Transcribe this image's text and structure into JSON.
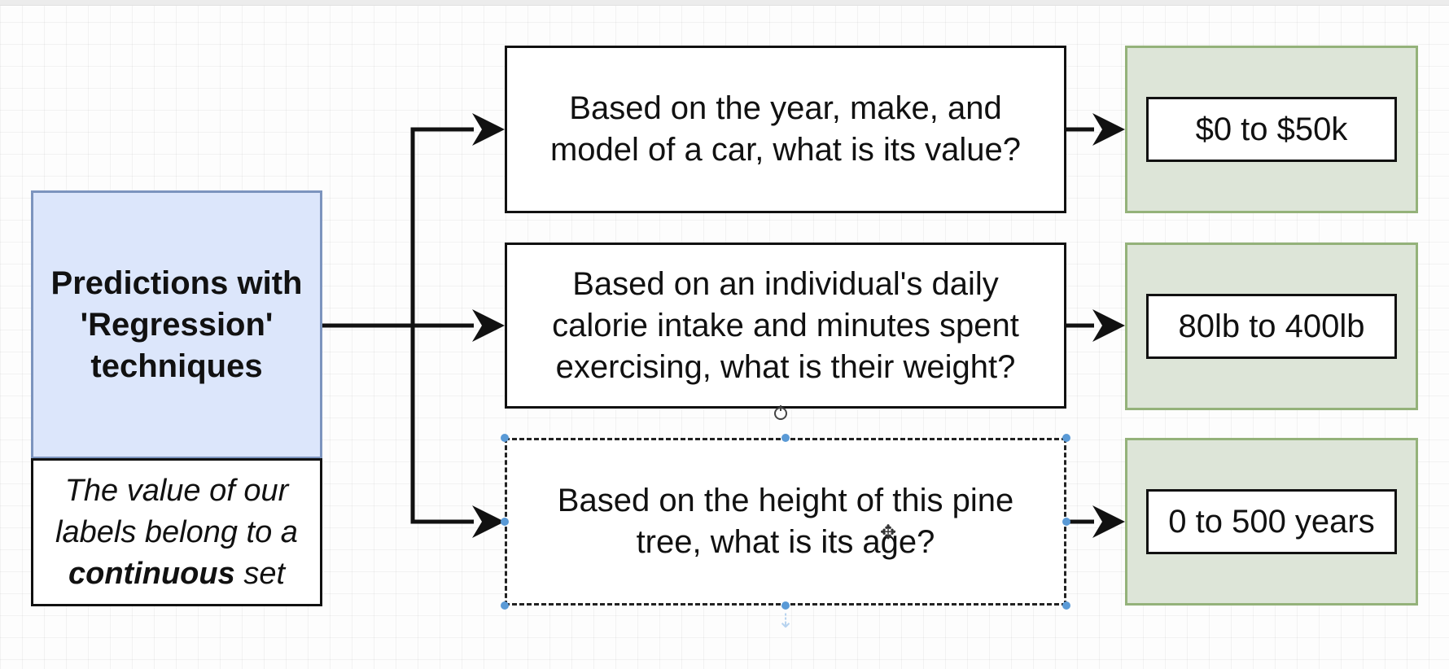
{
  "main": {
    "title": "Predictions with 'Regression' techniques",
    "note_part1": "The value of our labels belong to a",
    "note_bold": "continuous",
    "note_part2": "set"
  },
  "questions": [
    "Based on the year, make, and model of a car, what is its value?",
    "Based on an individual's daily calorie intake and minutes spent exercising, what is their weight?",
    "Based on the height of this pine tree, what is its age?"
  ],
  "ranges": [
    "$0 to $50k",
    "80lb to 400lb",
    "0 to 500 years"
  ],
  "icons": {
    "cursor": "move-cursor-icon",
    "rotate": "rotate-handle-icon",
    "connect": "connect-arrow-icon"
  },
  "colors": {
    "main_fill": "#dce6fb",
    "main_border": "#7c94be",
    "result_fill": "#dde5d8",
    "result_border": "#94b27a",
    "selection_handle": "#5a9ad6"
  }
}
